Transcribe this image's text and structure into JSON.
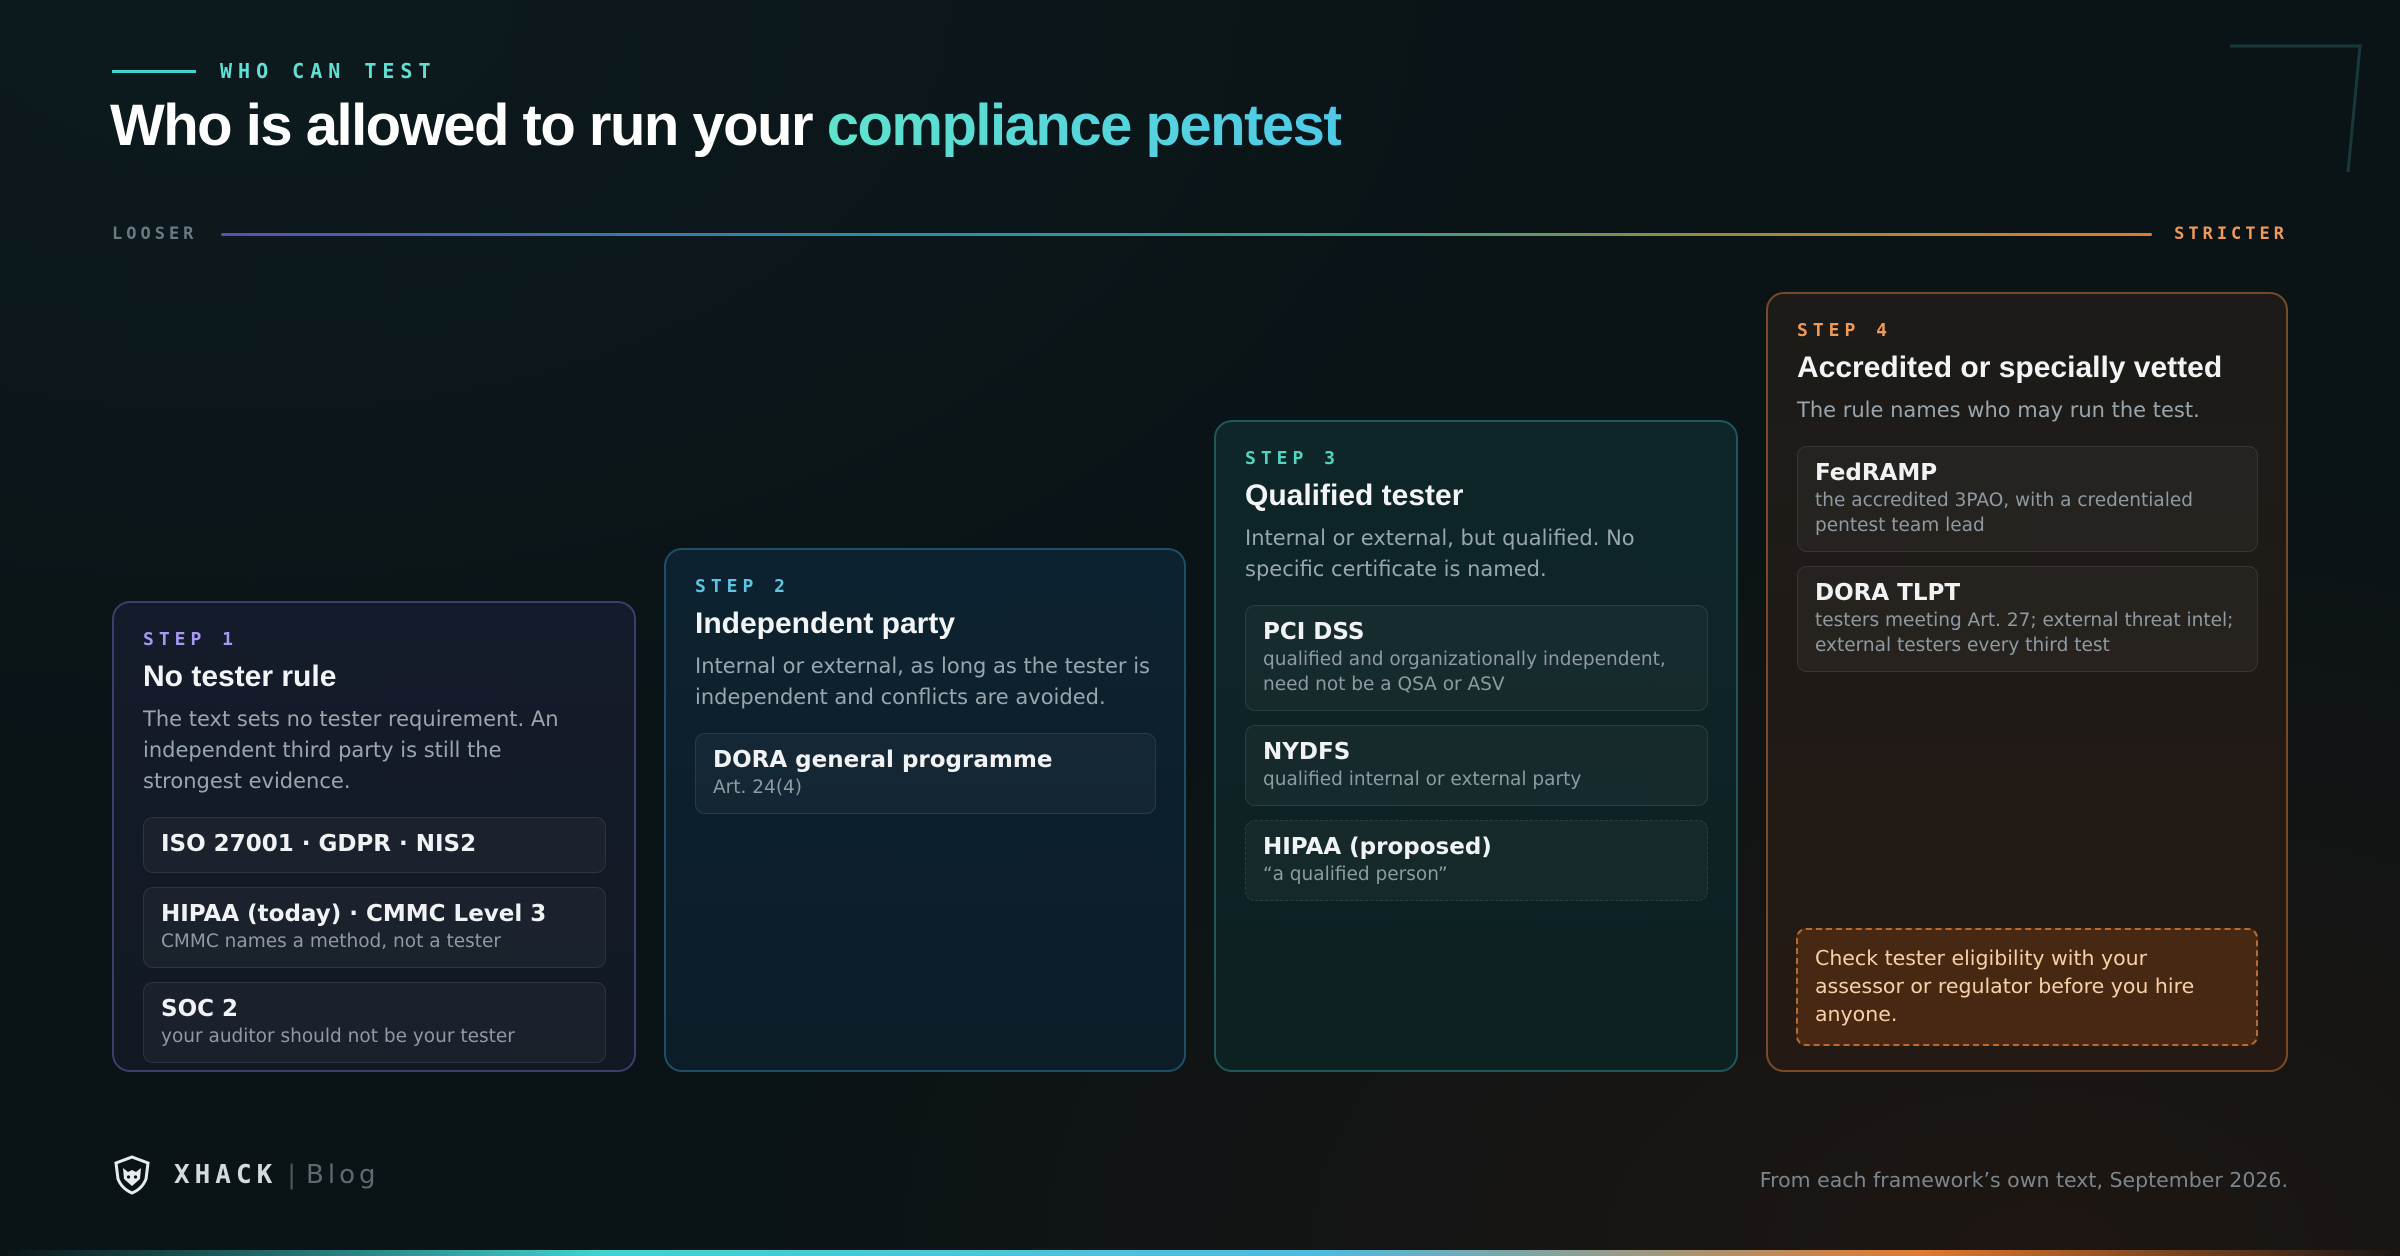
{
  "header": {
    "eyebrow": "WHO CAN TEST",
    "title_plain": "Who is allowed to run your ",
    "title_accent": "compliance pentest"
  },
  "scale": {
    "left_label": "LOOSER",
    "right_label": "STRICTER"
  },
  "steps": [
    {
      "step_label": "STEP 1",
      "name": "No tester rule",
      "description": "The text sets no tester requirement. An independent third party is still the strongest evidence.",
      "items": [
        {
          "title": "ISO 27001 · GDPR · NIS2",
          "subtitle": ""
        },
        {
          "title": "HIPAA (today) · CMMC Level 3",
          "subtitle": "CMMC names a method, not a tester"
        },
        {
          "title": "SOC 2",
          "subtitle": "your auditor should not be your tester"
        }
      ]
    },
    {
      "step_label": "STEP 2",
      "name": "Independent party",
      "description": "Internal or external, as long as the tester is independent and conflicts are avoided.",
      "items": [
        {
          "title": "DORA general programme",
          "subtitle": "Art. 24(4)"
        }
      ]
    },
    {
      "step_label": "STEP 3",
      "name": "Qualified tester",
      "description": "Internal or external, but qualified. No specific certificate is named.",
      "items": [
        {
          "title": "PCI DSS",
          "subtitle": "qualified and organizationally independent, need not be a QSA or ASV"
        },
        {
          "title": "NYDFS",
          "subtitle": "qualified internal or external party"
        },
        {
          "title": "HIPAA (proposed)",
          "subtitle": "“a qualified person”"
        }
      ]
    },
    {
      "step_label": "STEP 4",
      "name": "Accredited or specially vetted",
      "description": "The rule names who may run the test.",
      "items": [
        {
          "title": "FedRAMP",
          "subtitle": "the accredited 3PAO, with a credentialed pentest team lead"
        },
        {
          "title": "DORA TLPT",
          "subtitle": "testers meeting Art. 27; external threat intel; external testers every third test"
        }
      ],
      "note": "Check tester eligibility with your assessor or regulator before you hire anyone."
    }
  ],
  "footer": {
    "brand": "XHACK",
    "separator": "|",
    "section": "Blog",
    "source": "From each framework’s own text, September 2026.",
    "logo_icon": "fox-shield-icon"
  },
  "colors": {
    "background": "#0a1316",
    "accent_teal": "#3fd3cf",
    "step1": "#a79af0",
    "step2": "#5cc6e4",
    "step3": "#4fd6c0",
    "step4": "#f09a55"
  }
}
